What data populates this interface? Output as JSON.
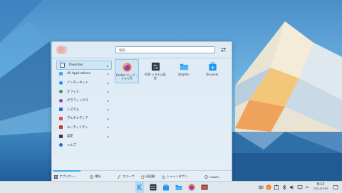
{
  "launcher": {
    "search": {
      "placeholder": "検索…",
      "value": ""
    },
    "categories": [
      {
        "label": "Favorites",
        "icon": "bookmark-icon",
        "active": true
      },
      {
        "label": "All Applications",
        "icon": "grid-icon"
      },
      {
        "label": "インターネット",
        "icon": "globe-icon"
      },
      {
        "label": "オフィス",
        "icon": "office-icon"
      },
      {
        "label": "グラフィックス",
        "icon": "graphics-icon"
      },
      {
        "label": "システム",
        "icon": "system-icon"
      },
      {
        "label": "マルチメディア",
        "icon": "multimedia-icon"
      },
      {
        "label": "ユーティリティ",
        "icon": "utilities-icon"
      },
      {
        "label": "設定",
        "icon": "settings-icon"
      },
      {
        "label": "ヘルプ",
        "icon": "help-icon"
      }
    ],
    "apps": [
      {
        "label": "Firefox ウェブ・ブラウザ",
        "icon": "firefox-icon",
        "selected": true
      },
      {
        "label": "KDE システム設定",
        "icon": "system-settings-icon"
      },
      {
        "label": "Dolphin",
        "icon": "folder-icon"
      },
      {
        "label": "Discover",
        "icon": "discover-icon"
      }
    ],
    "footer": {
      "applications": "アプリケー…",
      "places": "場所",
      "sleep": "スリープ",
      "restart": "再起動",
      "shutdown": "シャットダウン",
      "leave": "Leave..."
    }
  },
  "taskbar": {
    "clock_time": "8:13",
    "clock_date": "2021/07/29"
  },
  "colors": {
    "accent": "#3daee9",
    "selection": "#cfe5f3"
  }
}
